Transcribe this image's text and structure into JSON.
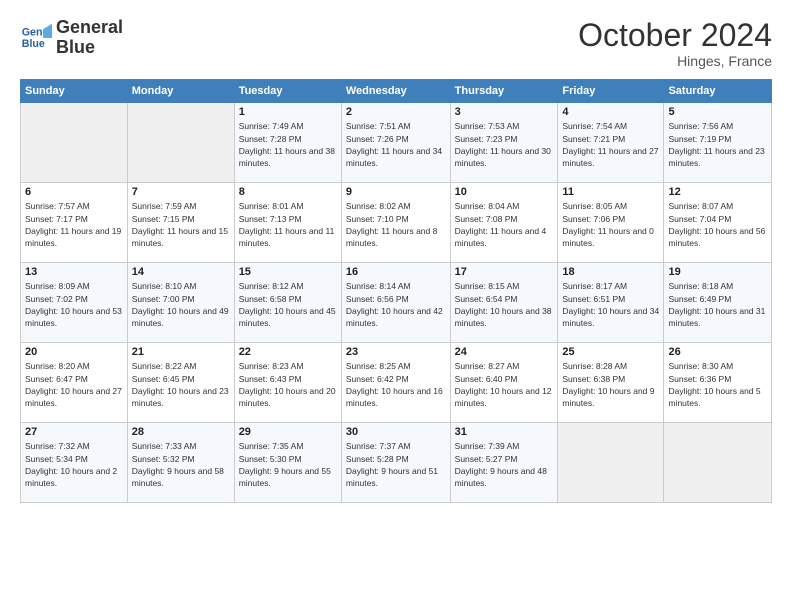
{
  "header": {
    "logo_line1": "General",
    "logo_line2": "Blue",
    "month": "October 2024",
    "location": "Hinges, France"
  },
  "weekdays": [
    "Sunday",
    "Monday",
    "Tuesday",
    "Wednesday",
    "Thursday",
    "Friday",
    "Saturday"
  ],
  "weeks": [
    [
      {
        "num": "",
        "info": ""
      },
      {
        "num": "",
        "info": ""
      },
      {
        "num": "1",
        "info": "Sunrise: 7:49 AM\nSunset: 7:28 PM\nDaylight: 11 hours and 38 minutes."
      },
      {
        "num": "2",
        "info": "Sunrise: 7:51 AM\nSunset: 7:26 PM\nDaylight: 11 hours and 34 minutes."
      },
      {
        "num": "3",
        "info": "Sunrise: 7:53 AM\nSunset: 7:23 PM\nDaylight: 11 hours and 30 minutes."
      },
      {
        "num": "4",
        "info": "Sunrise: 7:54 AM\nSunset: 7:21 PM\nDaylight: 11 hours and 27 minutes."
      },
      {
        "num": "5",
        "info": "Sunrise: 7:56 AM\nSunset: 7:19 PM\nDaylight: 11 hours and 23 minutes."
      }
    ],
    [
      {
        "num": "6",
        "info": "Sunrise: 7:57 AM\nSunset: 7:17 PM\nDaylight: 11 hours and 19 minutes."
      },
      {
        "num": "7",
        "info": "Sunrise: 7:59 AM\nSunset: 7:15 PM\nDaylight: 11 hours and 15 minutes."
      },
      {
        "num": "8",
        "info": "Sunrise: 8:01 AM\nSunset: 7:13 PM\nDaylight: 11 hours and 11 minutes."
      },
      {
        "num": "9",
        "info": "Sunrise: 8:02 AM\nSunset: 7:10 PM\nDaylight: 11 hours and 8 minutes."
      },
      {
        "num": "10",
        "info": "Sunrise: 8:04 AM\nSunset: 7:08 PM\nDaylight: 11 hours and 4 minutes."
      },
      {
        "num": "11",
        "info": "Sunrise: 8:05 AM\nSunset: 7:06 PM\nDaylight: 11 hours and 0 minutes."
      },
      {
        "num": "12",
        "info": "Sunrise: 8:07 AM\nSunset: 7:04 PM\nDaylight: 10 hours and 56 minutes."
      }
    ],
    [
      {
        "num": "13",
        "info": "Sunrise: 8:09 AM\nSunset: 7:02 PM\nDaylight: 10 hours and 53 minutes."
      },
      {
        "num": "14",
        "info": "Sunrise: 8:10 AM\nSunset: 7:00 PM\nDaylight: 10 hours and 49 minutes."
      },
      {
        "num": "15",
        "info": "Sunrise: 8:12 AM\nSunset: 6:58 PM\nDaylight: 10 hours and 45 minutes."
      },
      {
        "num": "16",
        "info": "Sunrise: 8:14 AM\nSunset: 6:56 PM\nDaylight: 10 hours and 42 minutes."
      },
      {
        "num": "17",
        "info": "Sunrise: 8:15 AM\nSunset: 6:54 PM\nDaylight: 10 hours and 38 minutes."
      },
      {
        "num": "18",
        "info": "Sunrise: 8:17 AM\nSunset: 6:51 PM\nDaylight: 10 hours and 34 minutes."
      },
      {
        "num": "19",
        "info": "Sunrise: 8:18 AM\nSunset: 6:49 PM\nDaylight: 10 hours and 31 minutes."
      }
    ],
    [
      {
        "num": "20",
        "info": "Sunrise: 8:20 AM\nSunset: 6:47 PM\nDaylight: 10 hours and 27 minutes."
      },
      {
        "num": "21",
        "info": "Sunrise: 8:22 AM\nSunset: 6:45 PM\nDaylight: 10 hours and 23 minutes."
      },
      {
        "num": "22",
        "info": "Sunrise: 8:23 AM\nSunset: 6:43 PM\nDaylight: 10 hours and 20 minutes."
      },
      {
        "num": "23",
        "info": "Sunrise: 8:25 AM\nSunset: 6:42 PM\nDaylight: 10 hours and 16 minutes."
      },
      {
        "num": "24",
        "info": "Sunrise: 8:27 AM\nSunset: 6:40 PM\nDaylight: 10 hours and 12 minutes."
      },
      {
        "num": "25",
        "info": "Sunrise: 8:28 AM\nSunset: 6:38 PM\nDaylight: 10 hours and 9 minutes."
      },
      {
        "num": "26",
        "info": "Sunrise: 8:30 AM\nSunset: 6:36 PM\nDaylight: 10 hours and 5 minutes."
      }
    ],
    [
      {
        "num": "27",
        "info": "Sunrise: 7:32 AM\nSunset: 5:34 PM\nDaylight: 10 hours and 2 minutes."
      },
      {
        "num": "28",
        "info": "Sunrise: 7:33 AM\nSunset: 5:32 PM\nDaylight: 9 hours and 58 minutes."
      },
      {
        "num": "29",
        "info": "Sunrise: 7:35 AM\nSunset: 5:30 PM\nDaylight: 9 hours and 55 minutes."
      },
      {
        "num": "30",
        "info": "Sunrise: 7:37 AM\nSunset: 5:28 PM\nDaylight: 9 hours and 51 minutes."
      },
      {
        "num": "31",
        "info": "Sunrise: 7:39 AM\nSunset: 5:27 PM\nDaylight: 9 hours and 48 minutes."
      },
      {
        "num": "",
        "info": ""
      },
      {
        "num": "",
        "info": ""
      }
    ]
  ]
}
